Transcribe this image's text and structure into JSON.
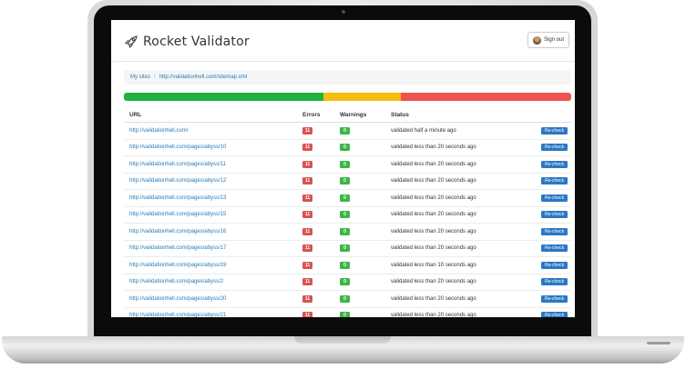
{
  "brand": {
    "name": "Rocket Validator",
    "signout_label": "Sign out"
  },
  "breadcrumb": {
    "root": "My sites",
    "separator": "/",
    "current": "http://validationhell.com/sitemap.xml"
  },
  "progress": {
    "segments": [
      {
        "name": "errors",
        "fraction": 0.447,
        "color": "#1fb141"
      },
      {
        "name": "warnings",
        "fraction": 0.173,
        "color": "#f4bd0b"
      },
      {
        "name": "failed",
        "fraction": 0.38,
        "color": "#ef5350"
      }
    ]
  },
  "table": {
    "headers": {
      "url": "URL",
      "errors": "Errors",
      "warnings": "Warnings",
      "status": "Status"
    },
    "rows": [
      {
        "url": "http://validationhell.com/",
        "errors": "11",
        "warnings": "0",
        "status": "validated half a minute ago",
        "action": "Re-check"
      },
      {
        "url": "http://validationhell.com/pages/abyss/10",
        "errors": "11",
        "warnings": "0",
        "status": "validated less than 20 seconds ago",
        "action": "Re-check"
      },
      {
        "url": "http://validationhell.com/pages/abyss/11",
        "errors": "11",
        "warnings": "0",
        "status": "validated less than 20 seconds ago",
        "action": "Re-check"
      },
      {
        "url": "http://validationhell.com/pages/abyss/12",
        "errors": "11",
        "warnings": "0",
        "status": "validated less than 20 seconds ago",
        "action": "Re-check"
      },
      {
        "url": "http://validationhell.com/pages/abyss/13",
        "errors": "11",
        "warnings": "0",
        "status": "validated less than 20 seconds ago",
        "action": "Re-check"
      },
      {
        "url": "http://validationhell.com/pages/abyss/15",
        "errors": "11",
        "warnings": "0",
        "status": "validated less than 20 seconds ago",
        "action": "Re-check"
      },
      {
        "url": "http://validationhell.com/pages/abyss/16",
        "errors": "11",
        "warnings": "0",
        "status": "validated less than 20 seconds ago",
        "action": "Re-check"
      },
      {
        "url": "http://validationhell.com/pages/abyss/17",
        "errors": "11",
        "warnings": "0",
        "status": "validated less than 20 seconds ago",
        "action": "Re-check"
      },
      {
        "url": "http://validationhell.com/pages/abyss/19",
        "errors": "11",
        "warnings": "0",
        "status": "validated less than 10 seconds ago",
        "action": "Re-check"
      },
      {
        "url": "http://validationhell.com/pages/abyss/2",
        "errors": "11",
        "warnings": "0",
        "status": "validated less than 20 seconds ago",
        "action": "Re-check"
      },
      {
        "url": "http://validationhell.com/pages/abyss/20",
        "errors": "11",
        "warnings": "0",
        "status": "validated less than 20 seconds ago",
        "action": "Re-check"
      },
      {
        "url": "http://validationhell.com/pages/abyss/21",
        "errors": "11",
        "warnings": "0",
        "status": "validated less than 20 seconds ago",
        "action": "Re-check"
      }
    ]
  }
}
